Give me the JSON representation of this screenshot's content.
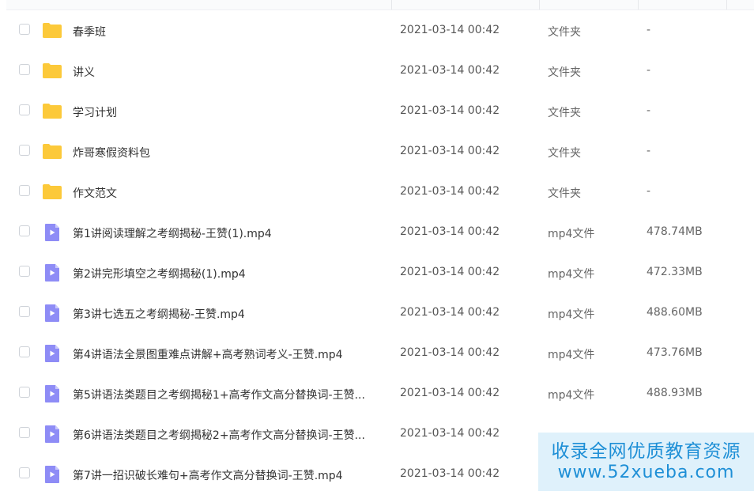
{
  "files": [
    {
      "name": "春季班",
      "date": "2021-03-14 00:42",
      "type": "文件夹",
      "size": "-",
      "icon": "folder-icon"
    },
    {
      "name": "讲义",
      "date": "2021-03-14 00:42",
      "type": "文件夹",
      "size": "-",
      "icon": "folder-icon"
    },
    {
      "name": "学习计划",
      "date": "2021-03-14 00:42",
      "type": "文件夹",
      "size": "-",
      "icon": "folder-icon"
    },
    {
      "name": "炸哥寒假资料包",
      "date": "2021-03-14 00:42",
      "type": "文件夹",
      "size": "-",
      "icon": "folder-icon"
    },
    {
      "name": "作文范文",
      "date": "2021-03-14 00:42",
      "type": "文件夹",
      "size": "-",
      "icon": "folder-icon"
    },
    {
      "name": "第1讲阅读理解之考纲揭秘-王赞(1).mp4",
      "date": "2021-03-14 00:42",
      "type": "mp4文件",
      "size": "478.74MB",
      "icon": "video-file-icon"
    },
    {
      "name": "第2讲完形填空之考纲揭秘(1).mp4",
      "date": "2021-03-14 00:42",
      "type": "mp4文件",
      "size": "472.33MB",
      "icon": "video-file-icon"
    },
    {
      "name": "第3讲七选五之考纲揭秘-王赞.mp4",
      "date": "2021-03-14 00:42",
      "type": "mp4文件",
      "size": "488.60MB",
      "icon": "video-file-icon"
    },
    {
      "name": "第4讲语法全景图重难点讲解+高考熟词考义-王赞.mp4",
      "date": "2021-03-14 00:42",
      "type": "mp4文件",
      "size": "473.76MB",
      "icon": "video-file-icon"
    },
    {
      "name": "第5讲语法类题目之考纲揭秘1+高考作文高分替换词-王赞...",
      "date": "2021-03-14 00:42",
      "type": "mp4文件",
      "size": "488.93MB",
      "icon": "video-file-icon"
    },
    {
      "name": "第6讲语法类题目之考纲揭秘2+高考作文高分替换词-王赞...",
      "date": "2021-03-14 00:42",
      "type": "",
      "size": "",
      "icon": "video-file-icon"
    },
    {
      "name": "第7讲一招识破长难句+高考作文高分替换词-王赞.mp4",
      "date": "2021-03-14 00:42",
      "type": "",
      "size": "",
      "icon": "video-file-icon"
    }
  ],
  "watermark": {
    "line1": "收录全网优质教育资源",
    "line2": "www.52xueba.com"
  },
  "colors": {
    "folder": "#fcc93a",
    "video": "#8e8cf6",
    "watermark_text": "#1e8fd6",
    "watermark_bg": "#dff1fb"
  }
}
